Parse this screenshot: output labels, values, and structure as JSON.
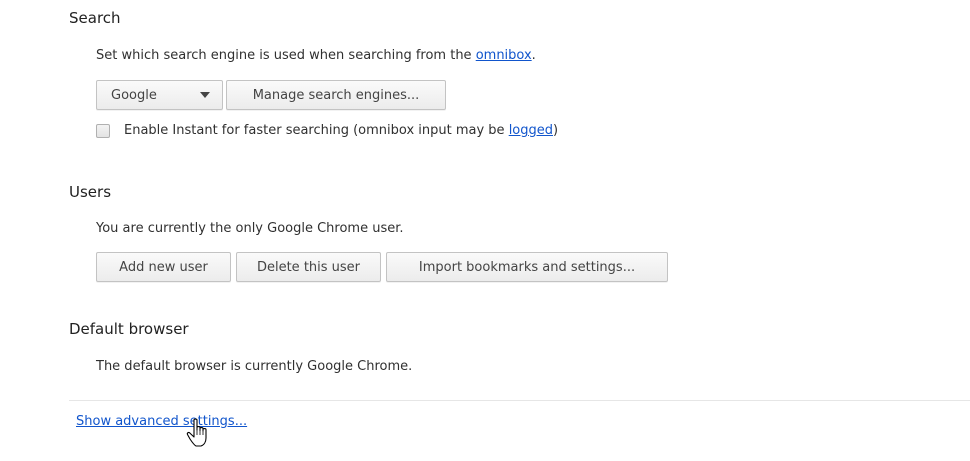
{
  "search": {
    "title": "Search",
    "desc_prefix": "Set which search engine is used when searching from the ",
    "desc_link": "omnibox",
    "desc_suffix": ".",
    "engine_selected": "Google",
    "manage_button": "Manage search engines...",
    "instant_prefix": "Enable Instant for faster searching (omnibox input may be ",
    "instant_link": "logged",
    "instant_suffix": ")"
  },
  "users": {
    "title": "Users",
    "desc": "You are currently the only Google Chrome user.",
    "add_button": "Add new user",
    "delete_button": "Delete this user",
    "import_button": "Import bookmarks and settings..."
  },
  "default_browser": {
    "title": "Default browser",
    "desc": "The default browser is currently Google Chrome."
  },
  "advanced_link": "Show advanced settings...",
  "icons": {
    "dropdown": "chevron-down-icon",
    "cursor": "hand-pointer-icon"
  },
  "colors": {
    "link": "#1155cc"
  }
}
